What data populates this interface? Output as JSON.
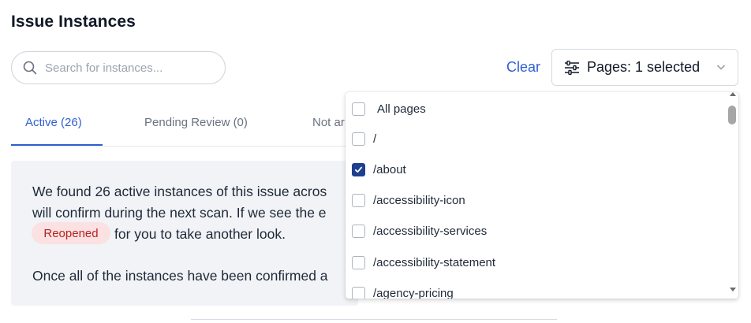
{
  "page": {
    "title": "Issue Instances"
  },
  "search": {
    "placeholder": "Search for instances..."
  },
  "filters": {
    "clear_label": "Clear",
    "pages_button_label": "Pages: 1 selected"
  },
  "tabs": [
    {
      "label": "Active (26)",
      "active": true
    },
    {
      "label": "Pending Review (0)",
      "active": false
    },
    {
      "label": "Not ar",
      "active": false
    }
  ],
  "info": {
    "line1": "We found 26 active instances of this issue acros",
    "line2": "will confirm during the next scan. If we see the e",
    "badge": "Reopened",
    "line3": "for you to take another look.",
    "line4": "Once all of the instances have been confirmed a"
  },
  "dropdown": {
    "options": [
      {
        "label": "All pages",
        "checked": false
      },
      {
        "label": "/",
        "checked": false
      },
      {
        "label": "/about",
        "checked": true
      },
      {
        "label": "/accessibility-icon",
        "checked": false
      },
      {
        "label": "/accessibility-services",
        "checked": false
      },
      {
        "label": "/accessibility-statement",
        "checked": false
      },
      {
        "label": "/agency-pricing",
        "checked": false
      }
    ]
  },
  "colors": {
    "accent": "#2f5fd0",
    "checkbox_checked": "#1f3f8f",
    "badge_bg": "#fbe1e1",
    "badge_text": "#b42323",
    "info_bg": "#f1f3f7"
  },
  "icons": {
    "search": "search-icon",
    "filter": "sliders-icon",
    "chevron": "chevron-down-icon",
    "check": "check-icon"
  }
}
